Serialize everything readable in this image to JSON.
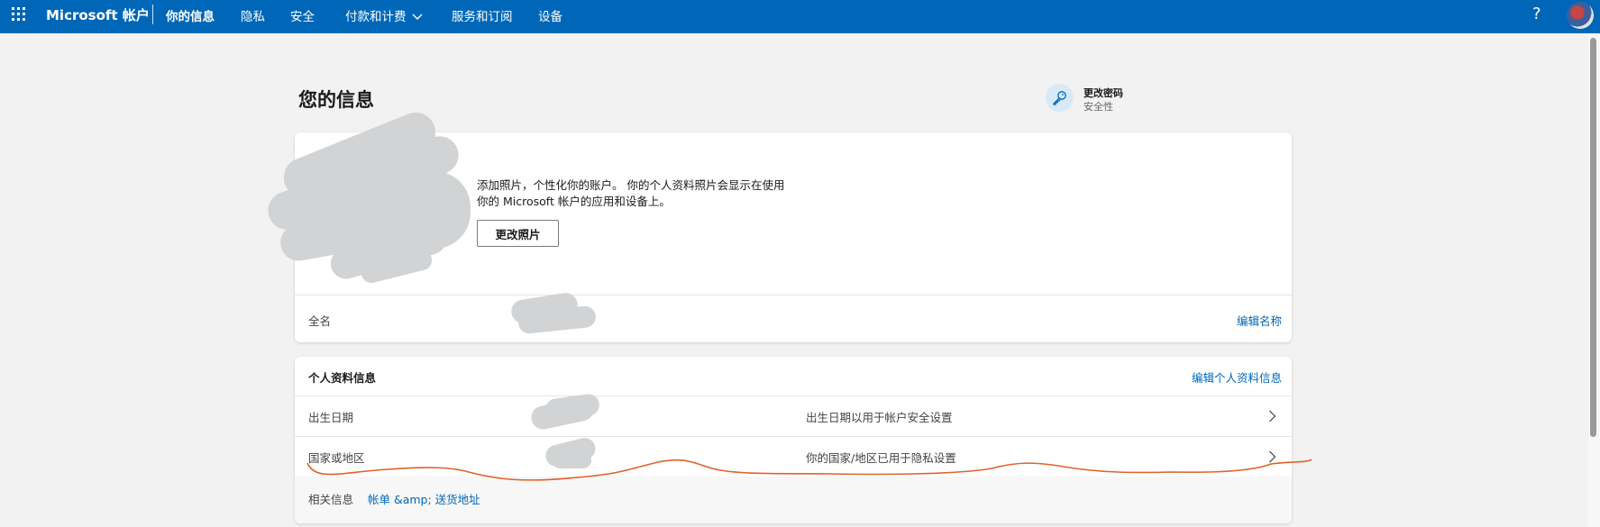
{
  "header": {
    "brand": "Microsoft 帐户",
    "nav": [
      "你的信息",
      "隐私",
      "安全",
      "付款和计费",
      "服务和订阅",
      "设备"
    ],
    "active_index": 0,
    "help": "?"
  },
  "page": {
    "title": "您的信息"
  },
  "password_card": {
    "title": "更改密码",
    "subtitle": "安全性"
  },
  "photo_section": {
    "description": "添加照片，个性化你的账户。 你的个人资料照片会显示在使用你的 Microsoft 帐户的应用和设备上。",
    "change_button": "更改照片",
    "name_label": "全名",
    "edit_name": "编辑名称"
  },
  "profile_section": {
    "heading": "个人资料信息",
    "edit_link": "编辑个人资料信息",
    "rows": [
      {
        "label": "出生日期",
        "note": "出生日期以用于帐户安全设置"
      },
      {
        "label": "国家或地区",
        "note": "你的国家/地区已用于隐私设置"
      }
    ],
    "related_label": "相关信息",
    "related_link": "帐单 &amp; 送货地址"
  },
  "colors": {
    "accent": "#0067b8",
    "annotation": "#e0622a"
  },
  "icons": [
    "waffle-icon",
    "chevron-down-icon",
    "key-icon",
    "chevron-right-icon"
  ]
}
